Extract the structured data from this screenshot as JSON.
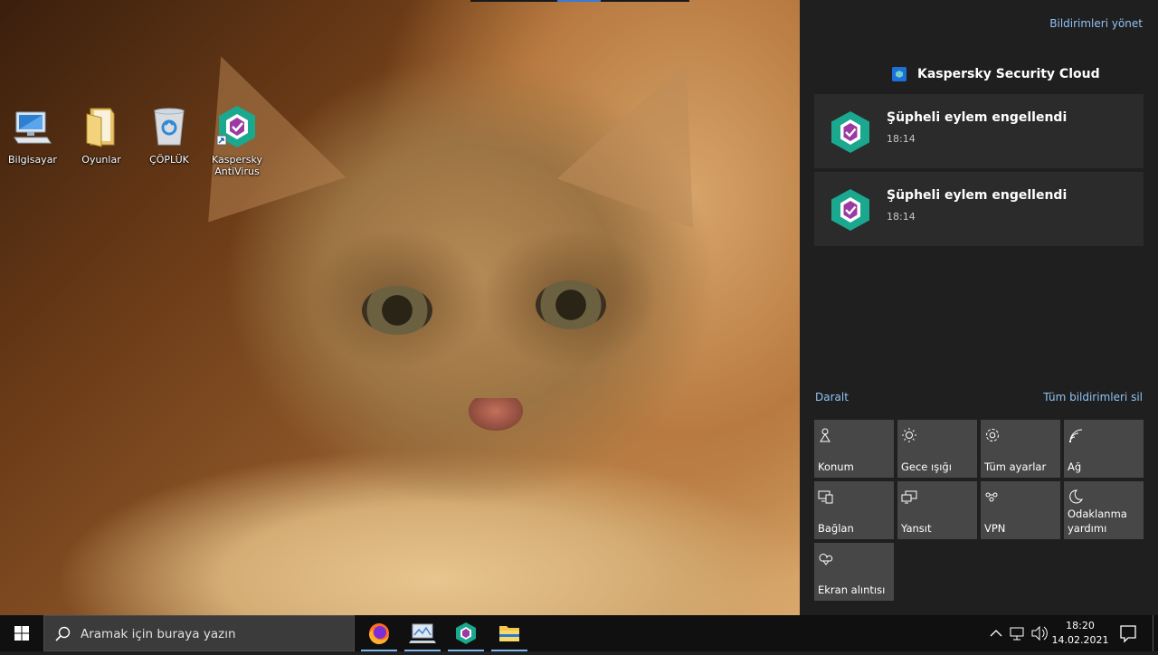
{
  "desktop": {
    "icons": [
      {
        "label": "Bilgisayar",
        "icon": "computer-icon"
      },
      {
        "label": "Oyunlar",
        "icon": "folder-icon"
      },
      {
        "label": "ÇÖPLÜK",
        "icon": "recycle-bin-icon"
      },
      {
        "label": "Kaspersky AntiVirus",
        "icon": "kaspersky-icon"
      }
    ]
  },
  "action_center": {
    "manage_label": "Bildirimleri yönet",
    "app_name": "Kaspersky Security Cloud",
    "notifications": [
      {
        "title": "Şüpheli eylem engellendi",
        "time": "18:14"
      },
      {
        "title": "Şüpheli eylem engellendi",
        "time": "18:14"
      }
    ],
    "collapse_label": "Daralt",
    "clear_all_label": "Tüm bildirimleri sil",
    "quick_actions": [
      {
        "label": "Konum",
        "icon": "location-icon"
      },
      {
        "label": "Gece ışığı",
        "icon": "night-light-icon"
      },
      {
        "label": "Tüm ayarlar",
        "icon": "settings-icon"
      },
      {
        "label": "Ağ",
        "icon": "network-icon"
      },
      {
        "label": "Bağlan",
        "icon": "connect-icon"
      },
      {
        "label": "Yansıt",
        "icon": "project-icon"
      },
      {
        "label": "VPN",
        "icon": "vpn-icon"
      },
      {
        "label": "Odaklanma yardımı",
        "icon": "focus-assist-icon"
      },
      {
        "label": "Ekran alıntısı",
        "icon": "screen-snip-icon"
      }
    ]
  },
  "taskbar": {
    "search_placeholder": "Aramak için buraya yazın",
    "apps": [
      "firefox-icon",
      "monitor-app-icon",
      "kaspersky-icon",
      "file-explorer-icon"
    ],
    "clock_time": "18:20",
    "clock_date": "14.02.2021",
    "accent": "#7fb8f0"
  },
  "colors": {
    "panel_bg": "#1f1f1f",
    "tile_bg": "#474747",
    "link": "#8fc3f5",
    "kaspersky_green": "#1aa88e"
  }
}
